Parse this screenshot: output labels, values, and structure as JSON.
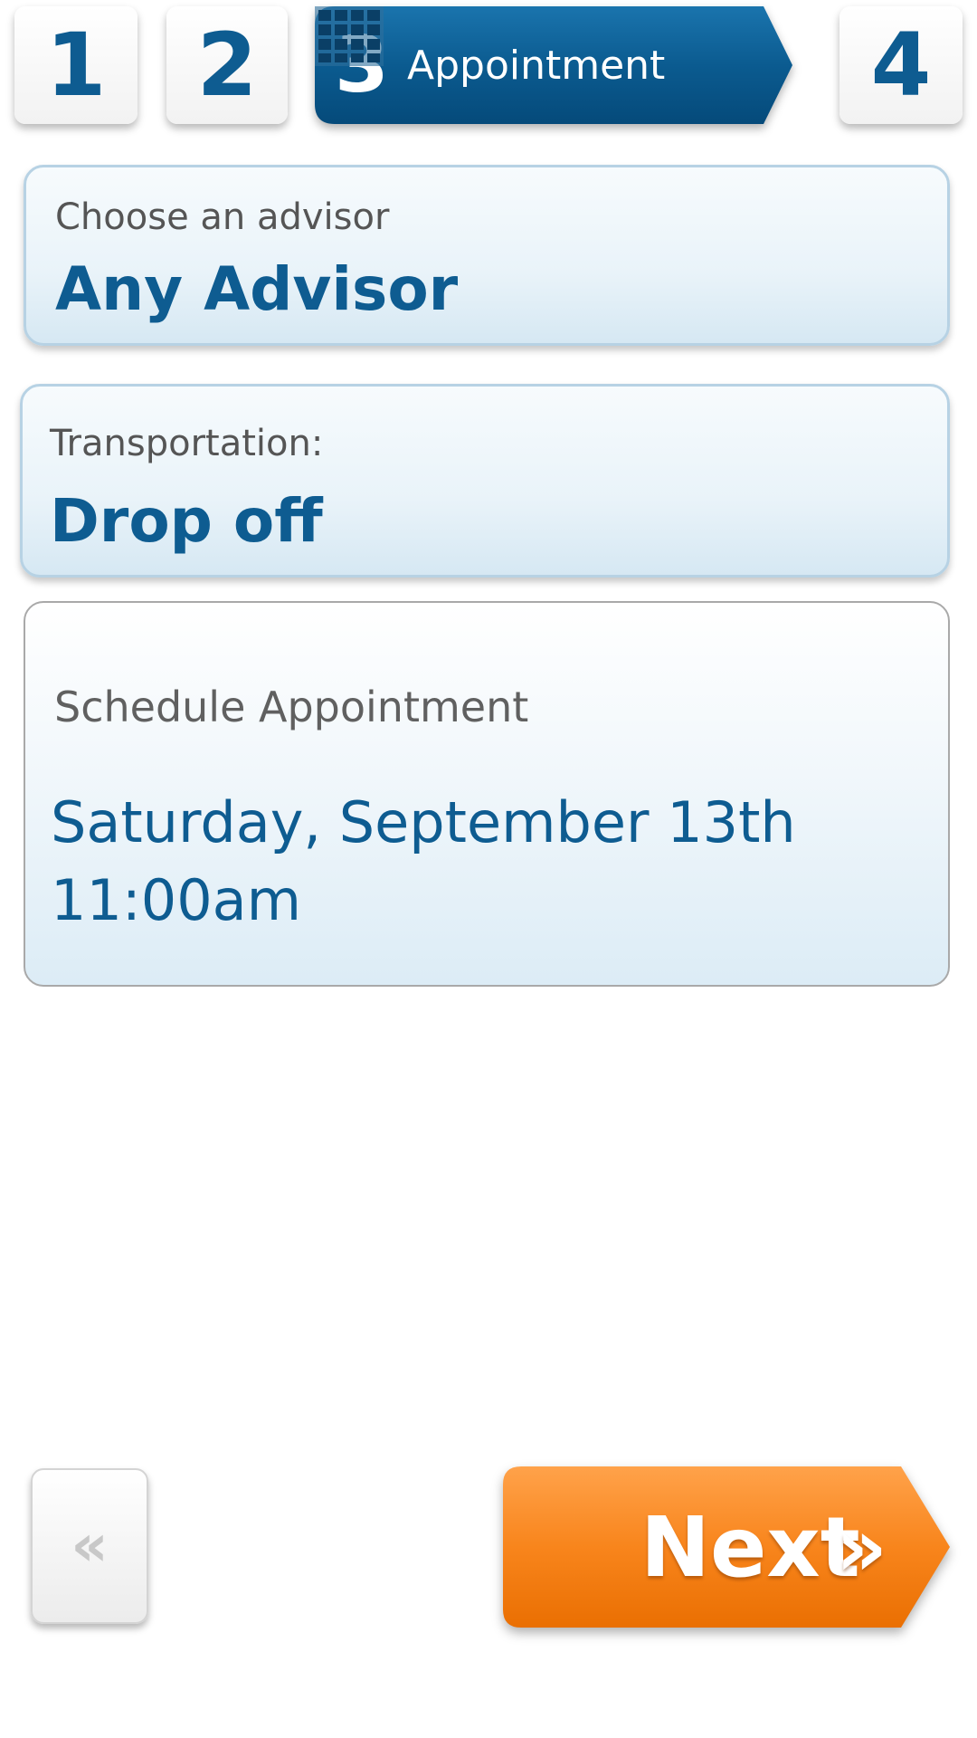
{
  "steps": {
    "step1": "1",
    "step2": "2",
    "step3_number": "3",
    "step3_label": "Appointment",
    "step4": "4",
    "current_step": 3
  },
  "advisor": {
    "label": "Choose an advisor",
    "value": "Any Advisor"
  },
  "transportation": {
    "label": "Transportation:",
    "value": "Drop off"
  },
  "schedule": {
    "label": "Schedule Appointment",
    "date": "Saturday, September 13th",
    "time": "11:00am"
  },
  "buttons": {
    "back_label": "«",
    "next_label": "Next",
    "next_arrows": "»"
  },
  "icons": {
    "calendar": "calendar-icon",
    "back": "double-chevron-left-icon",
    "next": "double-chevron-right-icon"
  },
  "colors": {
    "primary_blue": "#0e5c91",
    "accent_orange": "#f57e10",
    "card_border": "#b7d2e4"
  }
}
